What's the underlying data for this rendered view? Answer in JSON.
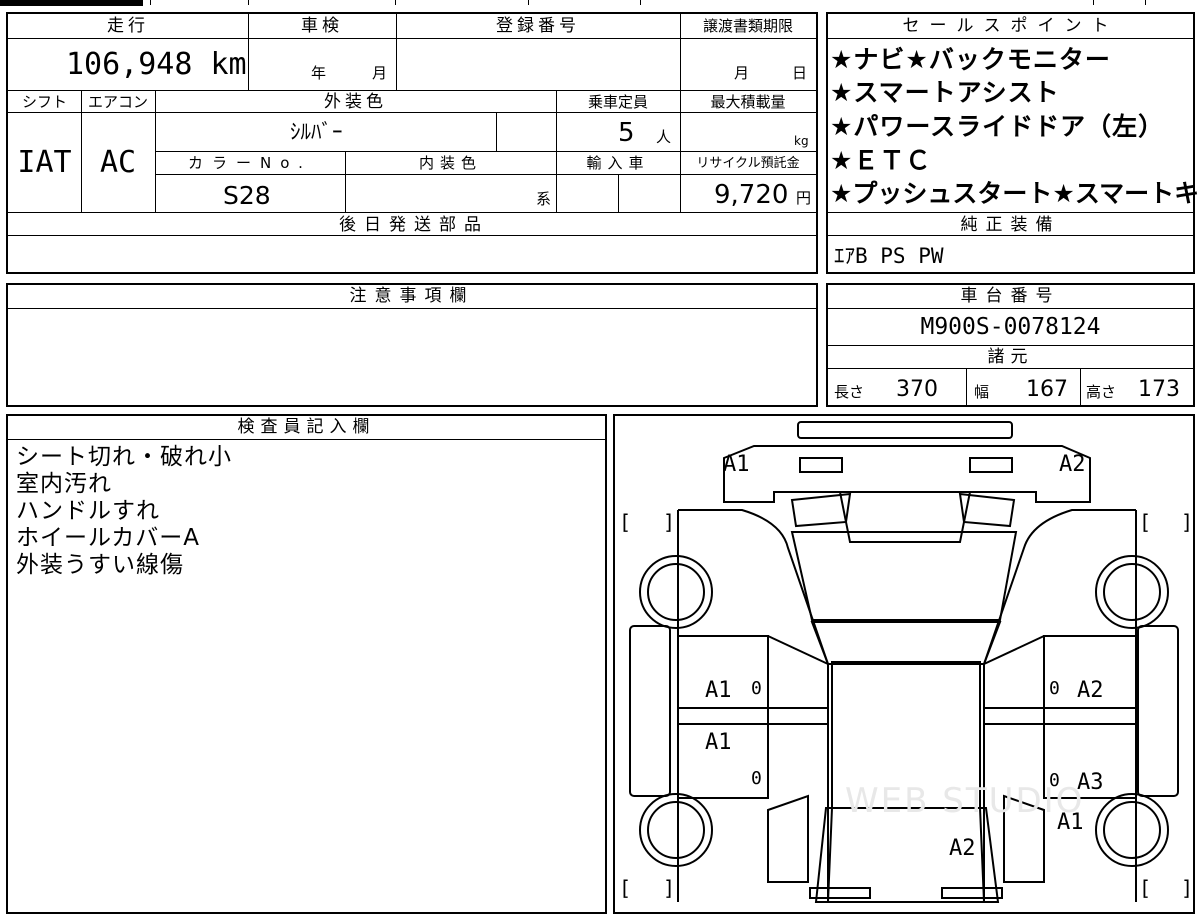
{
  "header": {
    "mileage_label": "走行",
    "mileage_value": "106,948 km",
    "inspection_label": "車検",
    "inspection_year": "年",
    "inspection_month": "月",
    "registration_label": "登録番号",
    "transfer_label": "譲渡書類期限",
    "transfer_month": "月",
    "transfer_day": "日",
    "shift_label": "シフト",
    "shift_value": "IAT",
    "ac_label": "エアコン",
    "ac_value": "AC",
    "exterior_label": "外装色",
    "exterior_value": "ｼﾙﾊﾞｰ",
    "capacity_label": "乗車定員",
    "capacity_value": "5",
    "capacity_unit": "人",
    "payload_label": "最大積載量",
    "payload_unit": "kg",
    "color_no_label": "カラーNo.",
    "color_no_value": "S28",
    "interior_label": "内装色",
    "interior_unit": "系",
    "import_label": "輸入車",
    "recycle_label": "リサイクル預託金",
    "recycle_value": "9,720",
    "recycle_unit": "円",
    "later_parts_label": "後日発送部品"
  },
  "sales_points": {
    "label": "セールスポイント",
    "items": [
      "★ナビ★バックモニター",
      "★スマートアシスト",
      "★パワースライドドア（左）",
      "★ＥＴＣ",
      "★プッシュスタート★スマートキー"
    ]
  },
  "genuine": {
    "label": "純正装備",
    "value": "ｴｱB PS PW"
  },
  "caution": {
    "label": "注意事項欄"
  },
  "chassis": {
    "label": "車台番号",
    "value": "M900S-0078124",
    "specs_label": "諸元",
    "length_label": "長さ",
    "length_value": "370",
    "width_label": "幅",
    "width_value": "167",
    "height_label": "高さ",
    "height_value": "173"
  },
  "inspector": {
    "label": "検査員記入欄",
    "notes": [
      "シート切れ・破れ小",
      "室内汚れ",
      "ハンドルすれ",
      "ホイールカバーA",
      "外装うすい線傷"
    ]
  },
  "diagram": {
    "marks": {
      "front_left": "A1",
      "front_right": "A2",
      "door_left_front": "A1",
      "door_left_rear": "A1",
      "door_right_front": "A2",
      "door_right_rear": "A3",
      "rear_right_fender": "A1",
      "rear_body": "A2",
      "zero_lf": "0",
      "zero_lr": "0",
      "zero_rf": "0",
      "zero_rr": "0"
    },
    "bracket_open": "[",
    "bracket_close": "]",
    "watermark": "WEB STUDIO"
  }
}
